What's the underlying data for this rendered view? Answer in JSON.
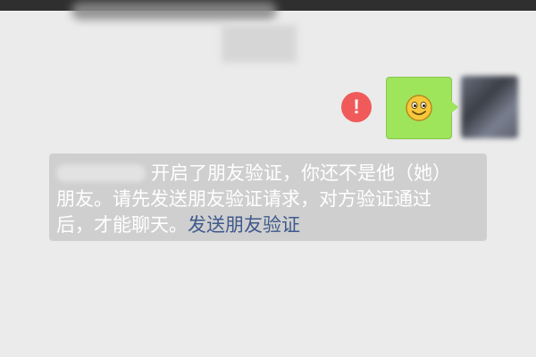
{
  "chat": {
    "message": {
      "status_icon": "exclamation-icon",
      "status_glyph": "!",
      "content_icon": "smiley-emoji-icon",
      "bubble_color": "#9fe55c",
      "status_color": "#f05a5a"
    },
    "system_notice": {
      "text_part1": "开启了朋友验证，你还不是他（她）",
      "text_part2": "朋友。请先发送朋友验证请求，对方验证通过",
      "text_part3": "后，才能聊天。",
      "link_label": "发送朋友验证",
      "link_color": "#3f5a8c"
    }
  }
}
